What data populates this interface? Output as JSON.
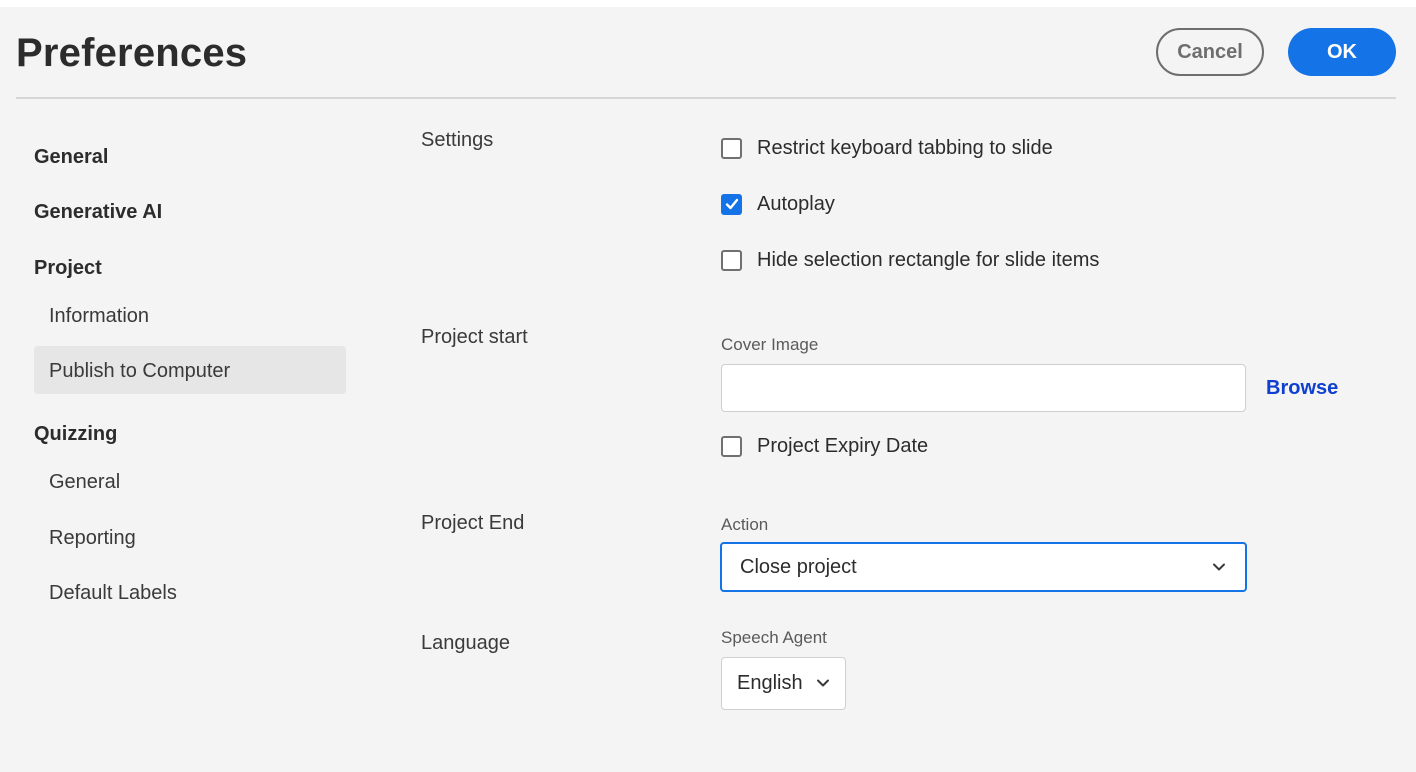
{
  "dialog": {
    "title": "Preferences",
    "cancel_label": "Cancel",
    "ok_label": "OK",
    "accent_color": "#1473e6"
  },
  "sidebar": {
    "items": [
      {
        "label": "General",
        "level": "section"
      },
      {
        "label": "Generative AI",
        "level": "section"
      },
      {
        "label": "Project",
        "level": "section"
      },
      {
        "label": "Information",
        "level": "child"
      },
      {
        "label": "Publish to Computer",
        "level": "child",
        "selected": true
      },
      {
        "label": "Quizzing",
        "level": "section"
      },
      {
        "label": "General",
        "level": "child"
      },
      {
        "label": "Reporting",
        "level": "child"
      },
      {
        "label": "Default Labels",
        "level": "child"
      }
    ]
  },
  "main": {
    "settings": {
      "label": "Settings",
      "options": [
        {
          "label": "Restrict keyboard tabbing to slide",
          "checked": false
        },
        {
          "label": "Autoplay",
          "checked": true
        },
        {
          "label": "Hide selection rectangle for slide items",
          "checked": false
        }
      ]
    },
    "project_start": {
      "label": "Project start",
      "cover_image_label": "Cover Image",
      "cover_image_value": "",
      "browse_label": "Browse",
      "expiry_label": "Project Expiry Date",
      "expiry_checked": false
    },
    "project_end": {
      "label": "Project End",
      "action_label": "Action",
      "action_value": "Close project"
    },
    "language": {
      "label": "Language",
      "speech_agent_label": "Speech Agent",
      "speech_agent_value": "English"
    }
  }
}
